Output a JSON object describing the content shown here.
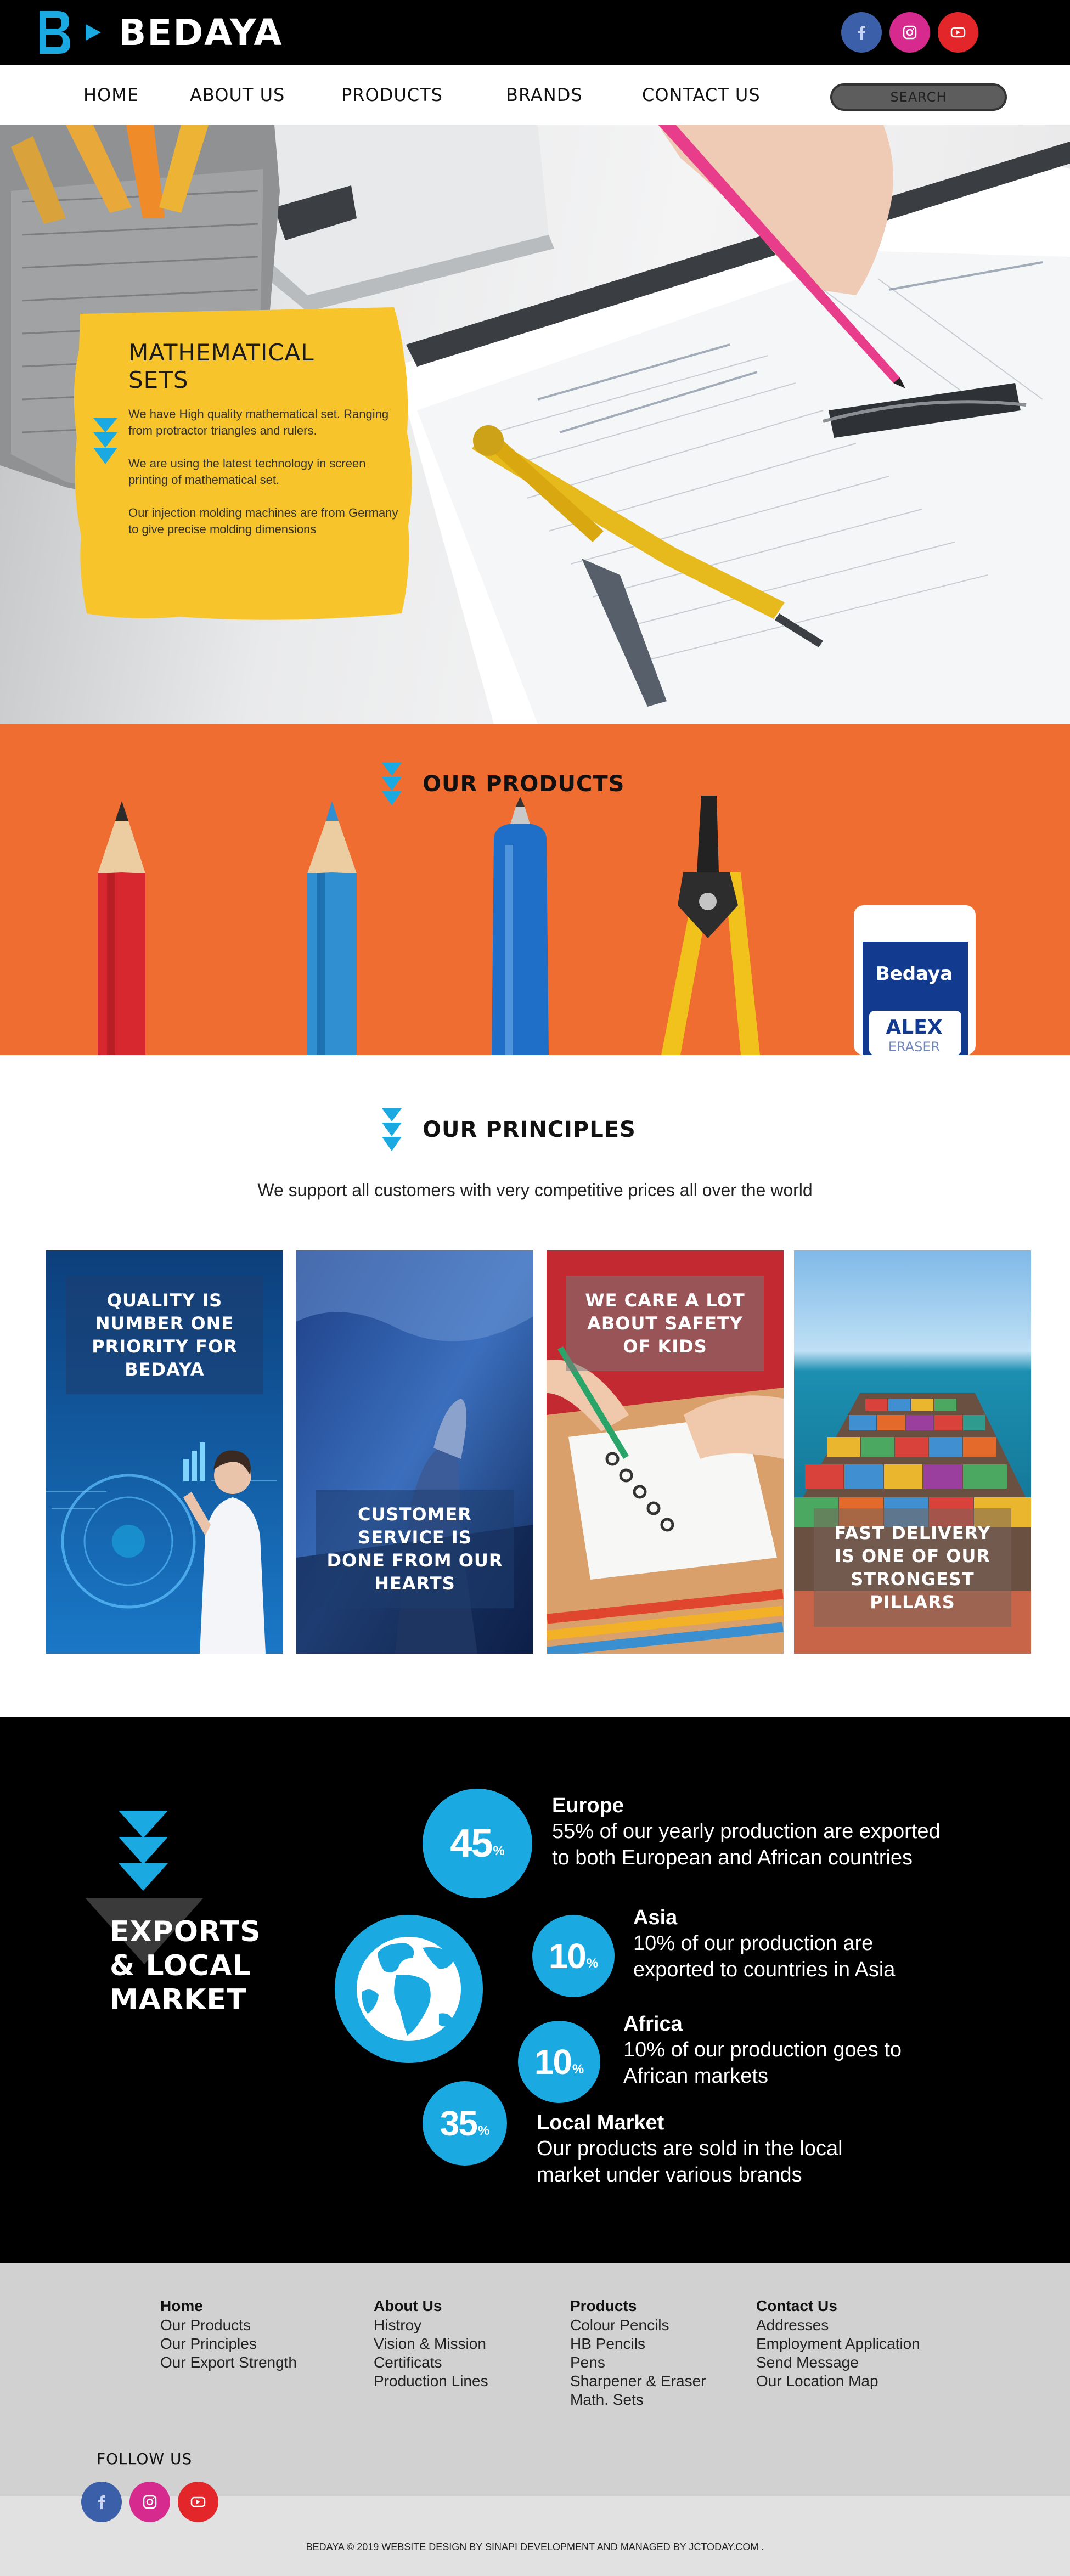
{
  "brand": {
    "name": "BEDAYA"
  },
  "nav": {
    "items": [
      {
        "label": "HOME"
      },
      {
        "label": "ABOUT US"
      },
      {
        "label": "PRODUCTS"
      },
      {
        "label": "BRANDS"
      },
      {
        "label": "CONTACT US"
      }
    ],
    "search_label": "SEARCH"
  },
  "social": {
    "facebook_icon": "facebook-icon",
    "instagram_icon": "instagram-icon",
    "youtube_icon": "youtube-icon"
  },
  "hero": {
    "title_line1": "MATHEMATICAL",
    "title_line2": "SETS",
    "para1": "We have High quality mathematical set. Ranging from protractor triangles and rulers.",
    "para2": "We are using the latest technology in screen printing of mathematical set.",
    "para3": "Our injection molding machines are from Germany to give precise molding dimensions"
  },
  "products": {
    "title": "OUR PRODUCTS",
    "eraser_brand": "Bedaya",
    "eraser_name": "ALEX",
    "eraser_sub": "ERASER"
  },
  "principles": {
    "title": "OUR PRINCIPLES",
    "subtitle": "We support all customers with very competitive prices all over the world",
    "cards": [
      {
        "label": "QUALITY IS NUMBER ONE PRIORITY FOR BEDAYA"
      },
      {
        "label": "CUSTOMER SERVICE IS DONE FROM OUR HEARTS"
      },
      {
        "label": "WE CARE A LOT ABOUT SAFETY OF KIDS"
      },
      {
        "label": "FAST DELIVERY IS ONE OF OUR STRONGEST PILLARS"
      }
    ]
  },
  "exports": {
    "title_line1": "EXPORTS",
    "title_line2": "& LOCAL",
    "title_line3": "MARKET",
    "percent_symbol": "%",
    "regions": [
      {
        "value": "45",
        "name": "Europe",
        "desc_line1": "55% of our yearly production are exported",
        "desc_line2": "to both European and African countries"
      },
      {
        "value": "10",
        "name": "Asia",
        "desc_line1": "10% of our production are",
        "desc_line2": "exported to countries in Asia"
      },
      {
        "value": "10",
        "name": "Africa",
        "desc_line1": "10% of our production goes to",
        "desc_line2": "African markets"
      },
      {
        "value": "35",
        "name": "Local Market",
        "desc_line1": "Our products are sold in the local",
        "desc_line2": "market under various brands"
      }
    ]
  },
  "footer": {
    "columns": [
      {
        "head": "Home",
        "links": [
          "Our Products",
          "Our Principles",
          "Our Export Strength"
        ]
      },
      {
        "head": "About Us",
        "links": [
          "Histroy",
          "Vision & Mission",
          "Certificats",
          "Production Lines"
        ]
      },
      {
        "head": "Products",
        "links": [
          "Colour Pencils",
          "HB Pencils",
          "Pens",
          "Sharpener & Eraser",
          "Math. Sets"
        ]
      },
      {
        "head": "Contact Us",
        "links": [
          "Addresses",
          "Employment Application",
          "Send Message",
          "Our Location Map"
        ]
      }
    ],
    "follow_label": "FOLLOW US",
    "copyright": "BEDAYA © 2019 WEBSITE DESIGN BY SINAPI DEVELOPMENT AND MANAGED BY JCTODAY.COM ."
  },
  "colors": {
    "accent_blue": "#1aa9e0",
    "products_orange": "#ef6d30",
    "hero_card_yellow": "#f7c52b"
  }
}
